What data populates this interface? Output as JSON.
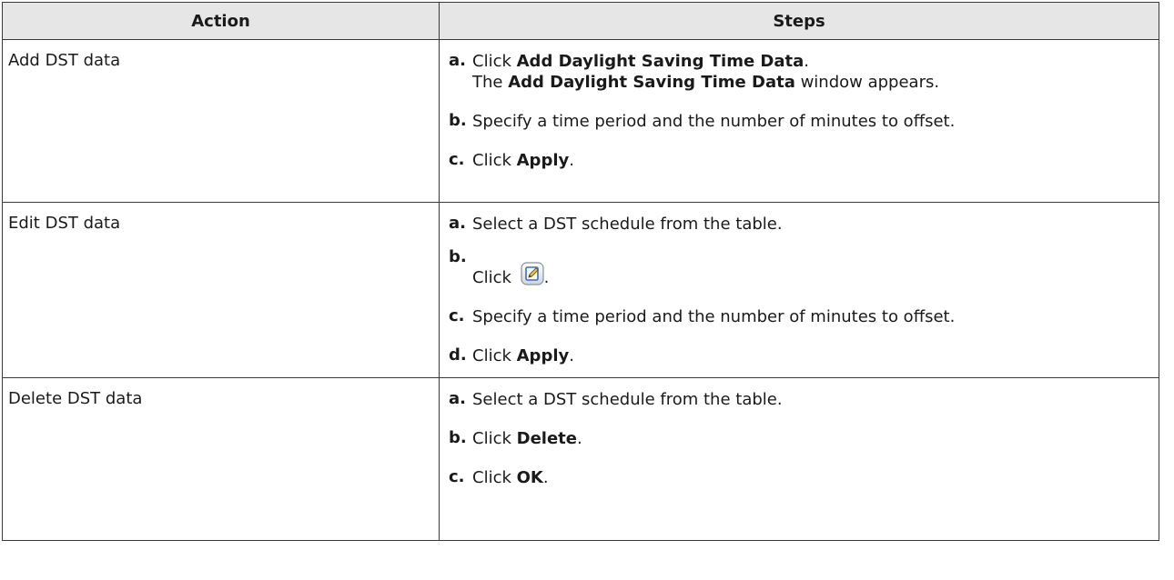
{
  "table": {
    "headers": [
      "Action",
      "Steps"
    ],
    "rows": [
      {
        "action": "Add DST data",
        "steps": [
          {
            "letter": "a.",
            "pre": "Click ",
            "bold": "Add Daylight Saving Time Data",
            "post": ".",
            "line2_pre": "The ",
            "line2_bold": "Add Daylight Saving Time Data",
            "line2_post": " window appears."
          },
          {
            "letter": "b.",
            "text": "Specify a time period and the number of minutes to offset."
          },
          {
            "letter": "c.",
            "pre": "Click ",
            "bold": "Apply",
            "post": "."
          }
        ]
      },
      {
        "action": "Edit DST data",
        "steps": [
          {
            "letter": "a.",
            "text": "Select a DST schedule from the table."
          },
          {
            "letter": "b.",
            "pre": "Click ",
            "icon": "edit-icon",
            "post": "."
          },
          {
            "letter": "c.",
            "text": "Specify a time period and the number of minutes to offset."
          },
          {
            "letter": "d.",
            "pre": "Click ",
            "bold": "Apply",
            "post": "."
          }
        ]
      },
      {
        "action": "Delete DST data",
        "steps": [
          {
            "letter": "a.",
            "text": "Select a DST schedule from the table."
          },
          {
            "letter": "b.",
            "pre": "Click ",
            "bold": "Delete",
            "post": "."
          },
          {
            "letter": "c.",
            "pre": "Click ",
            "bold": "OK",
            "post": "."
          }
        ]
      }
    ]
  },
  "colors": {
    "header_bg": "#e6e6e6",
    "border": "#3a3a3a",
    "icon_blue": "#3b6fb5"
  }
}
